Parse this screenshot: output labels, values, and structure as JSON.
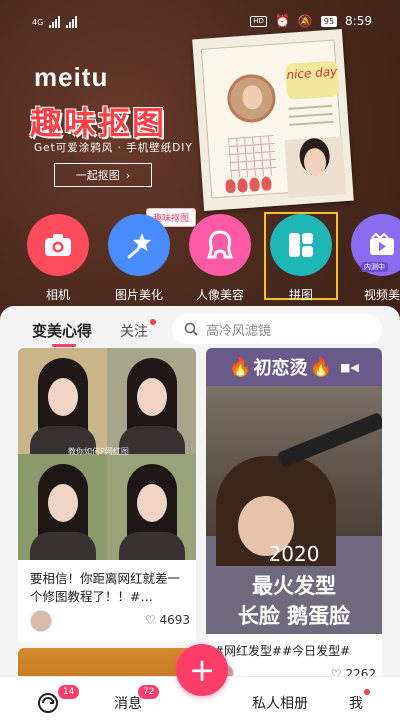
{
  "status_bar": {
    "carrier": "4G",
    "battery": "95",
    "time": "8:59",
    "hd": "HD"
  },
  "banner": {
    "brand": "meitu",
    "title": "趣味抠图",
    "subtitle": "Get可爱涂鸦风 · 手机壁纸DIY",
    "button": "一起抠图",
    "sticker": "nice day"
  },
  "features": {
    "tag": "趣味抠图",
    "items": [
      {
        "label": "相机",
        "icon": "camera-icon",
        "color": "#ff4b5c"
      },
      {
        "label": "图片美化",
        "icon": "magic-wand-icon",
        "color": "#4a8bff"
      },
      {
        "label": "人像美容",
        "icon": "face-icon",
        "color": "#ff5aa6"
      },
      {
        "label": "拼图",
        "icon": "collage-icon",
        "color": "#1fb6b6"
      },
      {
        "label": "视频美",
        "icon": "video-icon",
        "color": "#8a6cf0"
      }
    ],
    "video_badge": "内测中"
  },
  "tabs": {
    "main": "变美心得",
    "follow": "关注"
  },
  "search": {
    "placeholder": "高冷风滤镜"
  },
  "cards": [
    {
      "image_caption": "教你如何P网红图",
      "text": "要相信！你距离网红就差一个修图教程了！！#…",
      "likes": "4693"
    },
    {
      "header": "初恋烫",
      "line1": "2020",
      "line2": "最火发型",
      "line3": "长脸 鹅蛋脸",
      "tags": "#网红发型##今日发型#",
      "likes": "2262"
    }
  ],
  "bottom_nav": {
    "home_badge": "14",
    "messages": "消息",
    "messages_badge": "72",
    "plus": "+",
    "album": "私人相册",
    "me": "我"
  },
  "colors": {
    "accent": "#ff3d6a",
    "banner_bg": "#4b2a1e",
    "highlight": "#f4c326"
  }
}
